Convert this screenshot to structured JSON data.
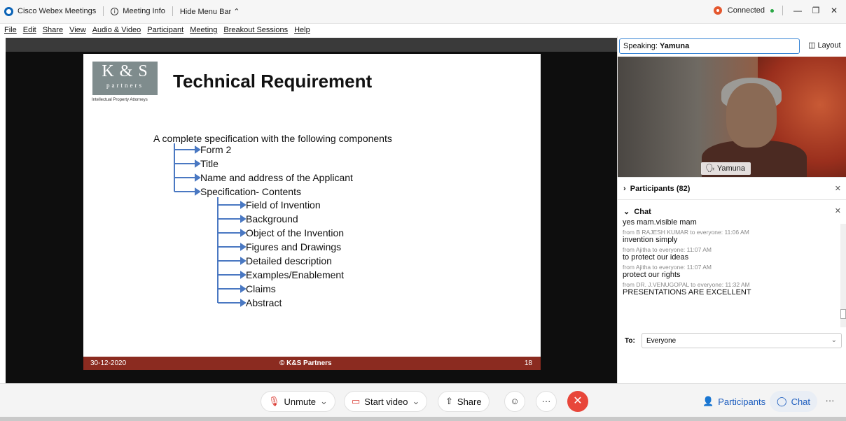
{
  "titlebar": {
    "app_name": "Cisco Webex Meetings",
    "meeting_info": "Meeting Info",
    "hide_menu": "Hide Menu Bar",
    "connection": "Connected"
  },
  "menu": [
    "File",
    "Edit",
    "Share",
    "View",
    "Audio & Video",
    "Participant",
    "Meeting",
    "Breakout Sessions",
    "Help"
  ],
  "slide": {
    "logo_main": "K & S",
    "logo_sub": "partners",
    "logo_tag": "Intellectual Property Attorneys",
    "title": "Technical Requirement",
    "intro": "A complete specification with the following components",
    "level1": [
      "Form 2",
      "Title",
      "Name and address of the Applicant",
      "Specification- Contents"
    ],
    "level2": [
      "Field of Invention",
      "Background",
      "Object of the Invention",
      "Figures and Drawings",
      "Detailed description",
      "Examples/Enablement",
      "Claims",
      "Abstract"
    ],
    "footer_date": "30-12-2020",
    "footer_copy": "© K&S Partners",
    "footer_page": "18"
  },
  "right_panel": {
    "speaking_label": "Speaking:",
    "speaking_name": "Yamuna",
    "layout_btn": "Layout",
    "video_name": "Yamuna",
    "participants_label": "Participants (82)",
    "chat_label": "Chat",
    "messages": [
      {
        "text": "yes mam.visible mam"
      },
      {
        "from": "from B RAJESH KUMAR to everyone:  11:06 AM",
        "text": "invention simply"
      },
      {
        "from": "from Ajitha to everyone:  11:07 AM",
        "text": "to protect our ideas"
      },
      {
        "from": "from Ajitha to everyone:  11:07 AM",
        "text": "protect our rights"
      },
      {
        "from": "from DR. J.VENUGOPAL to everyone:  11:32 AM",
        "text": "PRESENTATIONS ARE EXCELLENT"
      }
    ],
    "to_label": "To:",
    "to_value": "Everyone"
  },
  "toolbar": {
    "unmute": "Unmute",
    "start_video": "Start video",
    "share": "Share",
    "more": "···",
    "participants": "Participants",
    "chat": "Chat"
  }
}
